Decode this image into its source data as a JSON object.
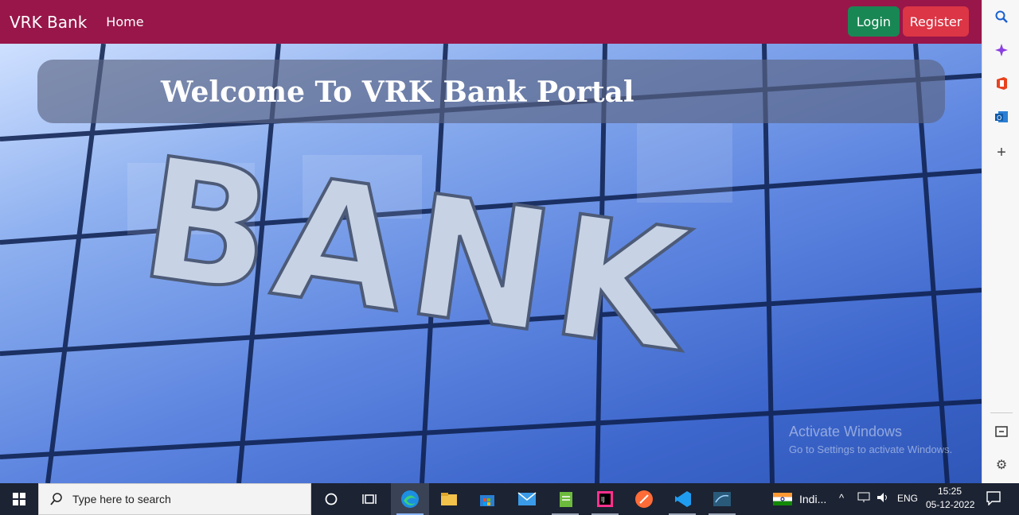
{
  "navbar": {
    "brand": "VRK Bank",
    "home": "Home",
    "login": "Login",
    "register": "Register"
  },
  "hero": {
    "welcome": "Welcome To VRK Bank Portal",
    "image_alt": "BANK",
    "watermark_title": "Activate Windows",
    "watermark_sub": "Go to Settings to activate Windows."
  },
  "edge_sidebar": {
    "icons": [
      "search-icon",
      "copilot-icon",
      "office-icon",
      "outlook-icon",
      "add-icon",
      "sidebar-toggle-icon",
      "settings-icon"
    ]
  },
  "taskbar": {
    "search_placeholder": "Type here to search",
    "language": "Indi...",
    "input": "ENG",
    "time": "15:25",
    "date": "05-12-2022"
  }
}
